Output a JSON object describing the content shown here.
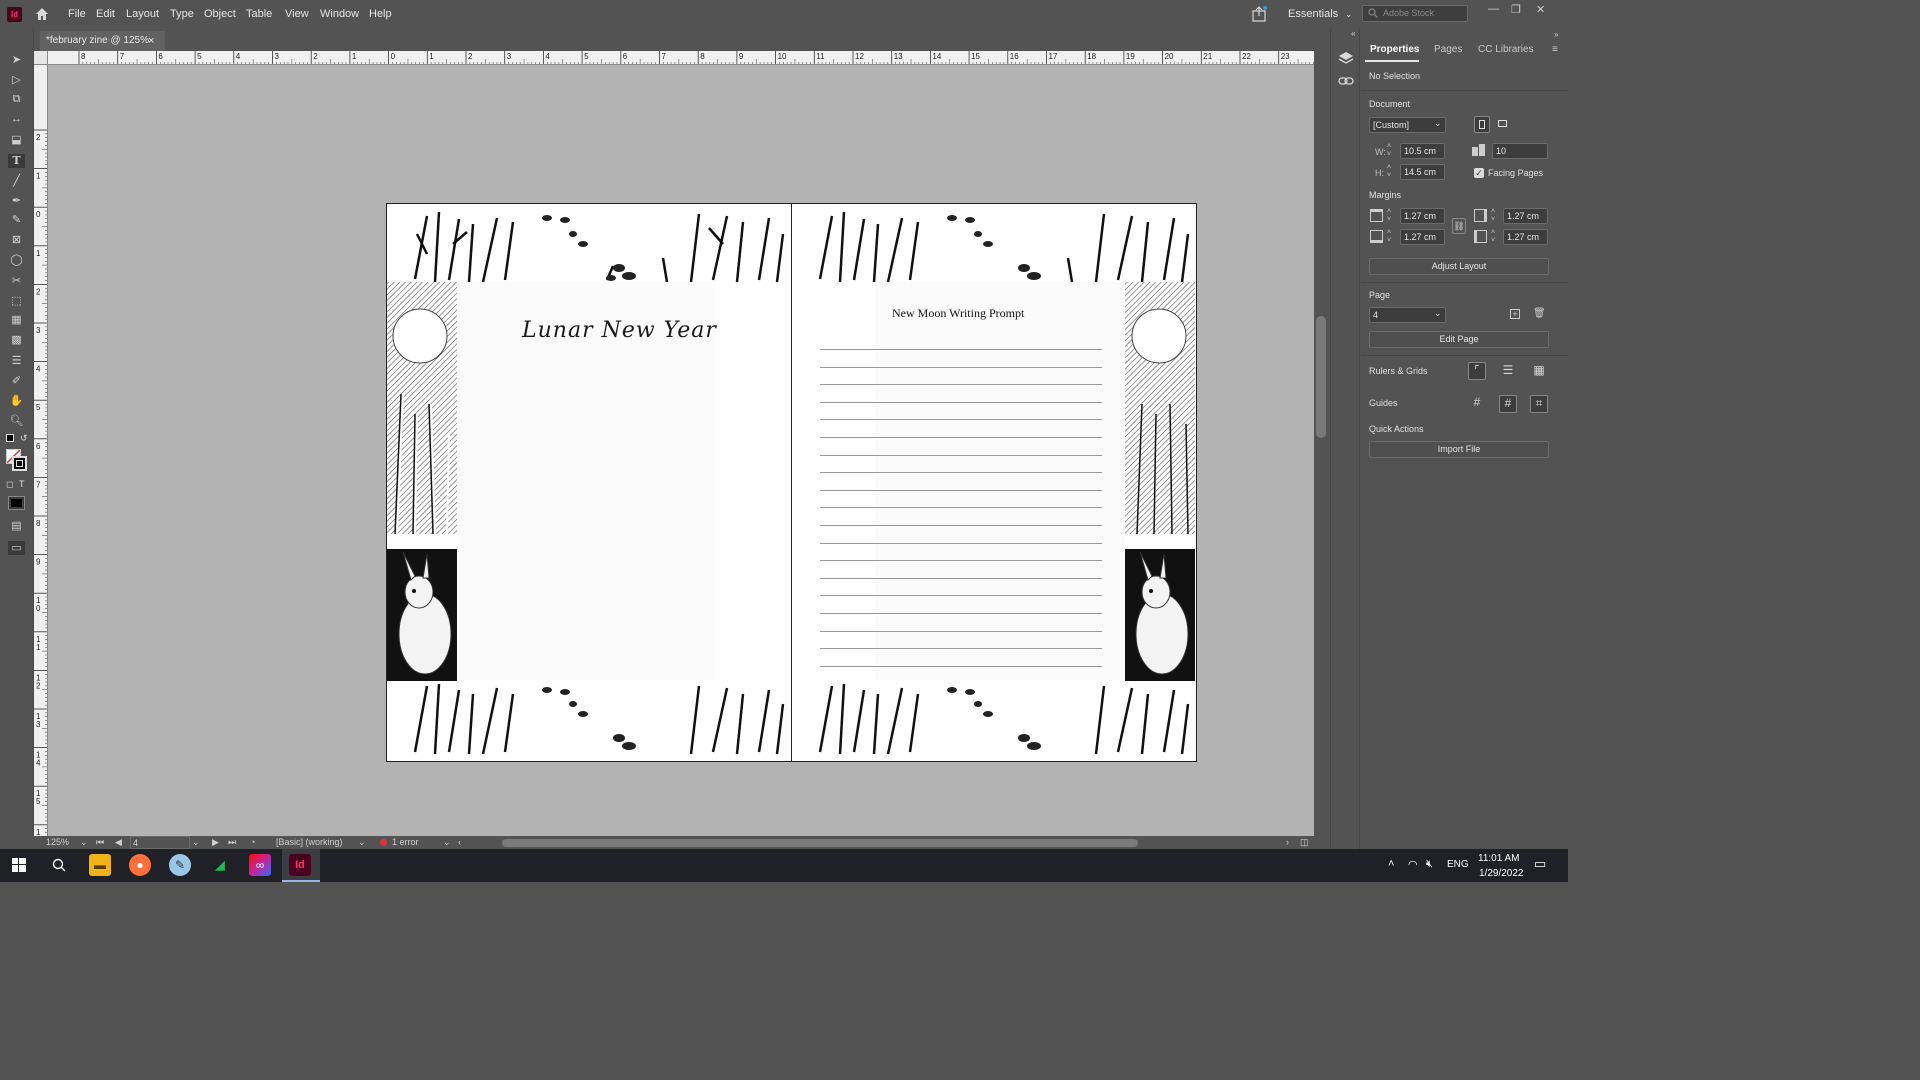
{
  "app": {
    "logo": "Id"
  },
  "menu": [
    "File",
    "Edit",
    "Layout",
    "Type",
    "Object",
    "Table",
    "View",
    "Window",
    "Help"
  ],
  "workspace": "Essentials",
  "stock_search": {
    "placeholder": "Adobe Stock"
  },
  "document_tab": {
    "title": "*february zine @ 125%",
    "close": "×"
  },
  "ruler_top_labels": [
    "8",
    "7",
    "6",
    "5",
    "4",
    "3",
    "2",
    "1",
    "0",
    "1",
    "2",
    "3",
    "4",
    "5",
    "6",
    "7",
    "8",
    "9",
    "10",
    "11",
    "12",
    "13",
    "14",
    "15",
    "16",
    "17",
    "18",
    "19",
    "20",
    "21",
    "22",
    "23"
  ],
  "ruler_left_labels": [
    "2",
    "1",
    "0",
    "1",
    "2",
    "3",
    "4",
    "5",
    "6",
    "7",
    "8",
    "9",
    "10",
    "11",
    "12",
    "13",
    "14",
    "15",
    "16"
  ],
  "spread": {
    "left_page_title": "Lunar New Year",
    "right_page_title": "New Moon Writing Prompt",
    "writing_lines": 19
  },
  "status_bar": {
    "zoom": "125%",
    "page": "4",
    "style": "[Basic] (working)",
    "errors": "1 error"
  },
  "properties_panel": {
    "tabs": [
      "Properties",
      "Pages",
      "CC Libraries"
    ],
    "selection": "No Selection",
    "document_label": "Document",
    "preset": "[Custom]",
    "width_label": "W:",
    "width": "10.5 cm",
    "height_label": "H:",
    "height": "14.5 cm",
    "pages_count": "10",
    "facing_pages": "Facing Pages",
    "facing_pages_checked": true,
    "margins_label": "Margins",
    "margin_top": "1.27 cm",
    "margin_bottom": "1.27 cm",
    "margin_inside": "1.27 cm",
    "margin_outside": "1.27 cm",
    "adjust_layout": "Adjust Layout",
    "page_label": "Page",
    "page_value": "4",
    "edit_page": "Edit Page",
    "rulers_grids": "Rulers & Grids",
    "guides": "Guides",
    "quick_actions": "Quick Actions",
    "import_file": "Import File"
  },
  "taskbar": {
    "language": "ENG",
    "time": "11:01 AM",
    "date": "1/29/2022"
  },
  "colors": {
    "ui_bg": "#535353",
    "pasteboard": "#b3b3b3",
    "accent_error": "#e0313a",
    "indesign_brand": "#ff3366"
  }
}
